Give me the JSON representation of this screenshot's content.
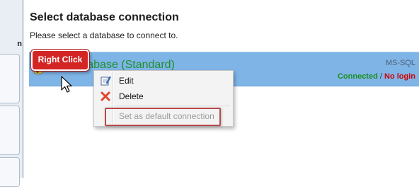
{
  "left_panel": {
    "label_fragment": "n"
  },
  "dialog": {
    "title": "Select database connection",
    "subtitle": "Please select a database to connect to."
  },
  "connection": {
    "name": "database (Standard)",
    "type": "MS-SQL",
    "status_connected": "Connected",
    "status_separator": "/",
    "status_login": "No login",
    "icon": "database-check-icon"
  },
  "context_menu": {
    "items": [
      {
        "label": "Edit",
        "icon": "edit-icon",
        "enabled": true
      },
      {
        "label": "Delete",
        "icon": "delete-x-icon",
        "enabled": true
      },
      {
        "label": "Set as default connection",
        "icon": "",
        "enabled": false
      }
    ]
  },
  "annotation": {
    "callout_label": "Right Click"
  },
  "colors": {
    "row_selected": "#7fb4e7",
    "connected": "#1d8f22",
    "no_login": "#d10000",
    "callout": "#d42525",
    "highlight_border": "#b84a4a"
  }
}
